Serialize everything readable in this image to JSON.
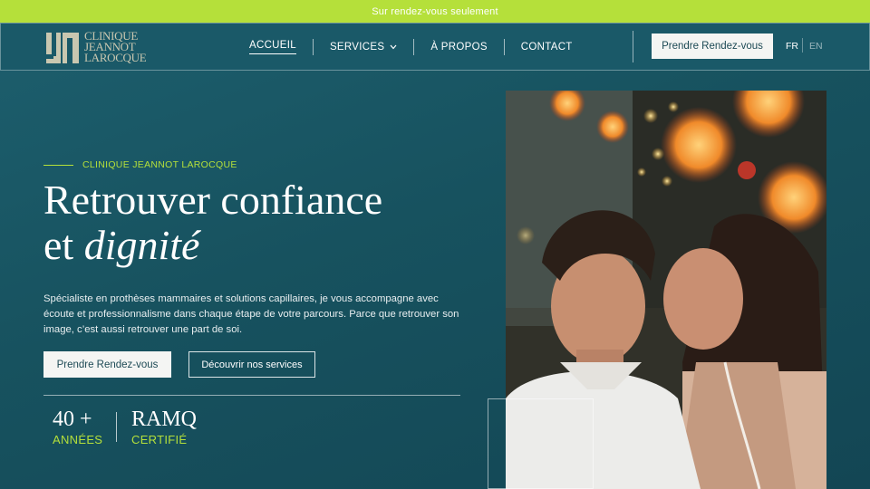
{
  "announcement": "Sur rendez-vous seulement",
  "logo": {
    "lines": [
      "CLINIQUE",
      "JEANNOT",
      "LAROCQUE"
    ]
  },
  "nav": {
    "items": [
      {
        "label": "ACCUEIL",
        "active": true
      },
      {
        "label": "SERVICES",
        "has_dropdown": true
      },
      {
        "label": "À PROPOS"
      },
      {
        "label": "CONTACT"
      }
    ],
    "cta": "Prendre Rendez-vous",
    "lang_fr": "FR",
    "lang_en": "EN"
  },
  "hero": {
    "eyebrow": "CLINIQUE JEANNOT LAROCQUE",
    "title_line1": "Retrouver confiance",
    "title_line2_plain": "et ",
    "title_line2_italic": "dignité",
    "description": "Spécialiste en prothèses mammaires et solutions capillaires, je vous accompagne avec écoute et professionnalisme dans chaque étape de votre parcours. Parce que retrouver son image, c’est aussi retrouver une part de soi.",
    "primary_button": "Prendre Rendez-vous",
    "secondary_button": "Découvrir nos services"
  },
  "stats": [
    {
      "value": "40 +",
      "label": "ANNÉES"
    },
    {
      "value": "RAMQ",
      "label": "CERTIFIÉ"
    }
  ],
  "colors": {
    "accent": "#b5e03a",
    "background": "#1a5968",
    "button_bg": "#f4f5f3"
  },
  "icons": {
    "dropdown": "chevron-down-icon"
  }
}
